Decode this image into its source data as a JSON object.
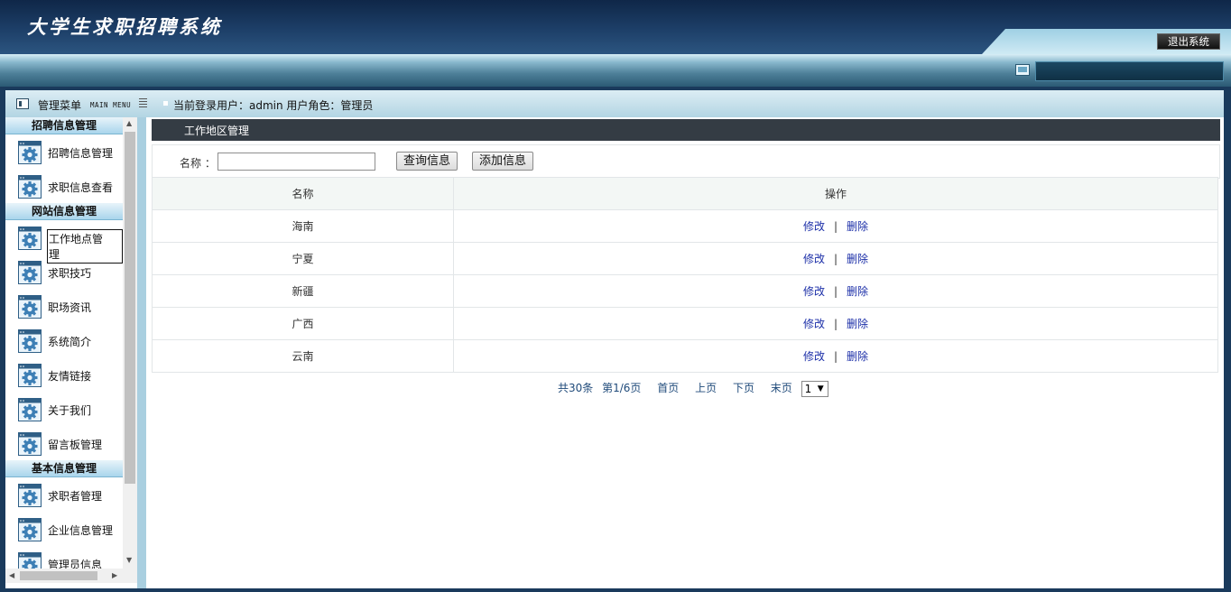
{
  "header": {
    "app_title": "大学生求职招聘系统",
    "logout_label": "退出系统"
  },
  "info_bar": {
    "menu_title": "管理菜单",
    "menu_title_en": "MAIN MENU",
    "user_info": "当前登录用户：admin  用户角色：管理员"
  },
  "sidebar": {
    "groups": [
      {
        "title": "招聘信息管理",
        "items": [
          "招聘信息管理",
          "求职信息查看"
        ]
      },
      {
        "title": "网站信息管理",
        "items": [
          "工作地点管理",
          "求职技巧",
          "职场资讯",
          "系统简介",
          "友情链接",
          "关于我们",
          "留言板管理"
        ]
      },
      {
        "title": "基本信息管理",
        "items": [
          "求职者管理",
          "企业信息管理",
          "管理员信息"
        ]
      }
    ],
    "selected_item": "工作地点管理"
  },
  "panel": {
    "title": "工作地区管理"
  },
  "search": {
    "label": "名称 ：",
    "value": "",
    "query_button": "查询信息",
    "add_button": "添加信息"
  },
  "table": {
    "columns": [
      "名称",
      "操作"
    ],
    "rows": [
      {
        "name": "海南",
        "edit": "修改",
        "delete": "删除"
      },
      {
        "name": "宁夏",
        "edit": "修改",
        "delete": "删除"
      },
      {
        "name": "新疆",
        "edit": "修改",
        "delete": "删除"
      },
      {
        "name": "广西",
        "edit": "修改",
        "delete": "删除"
      },
      {
        "name": "云南",
        "edit": "修改",
        "delete": "删除"
      }
    ],
    "separator": "|"
  },
  "pager": {
    "total": "共30条",
    "page_info": "第1/6页",
    "first": "首页",
    "prev": "上页",
    "next": "下页",
    "last": "末页",
    "selected_page": "1"
  },
  "icons": {
    "menu": "menu-list-icon",
    "sidebar_item": "gear-window-icon",
    "header_monitor": "monitor-icon"
  }
}
